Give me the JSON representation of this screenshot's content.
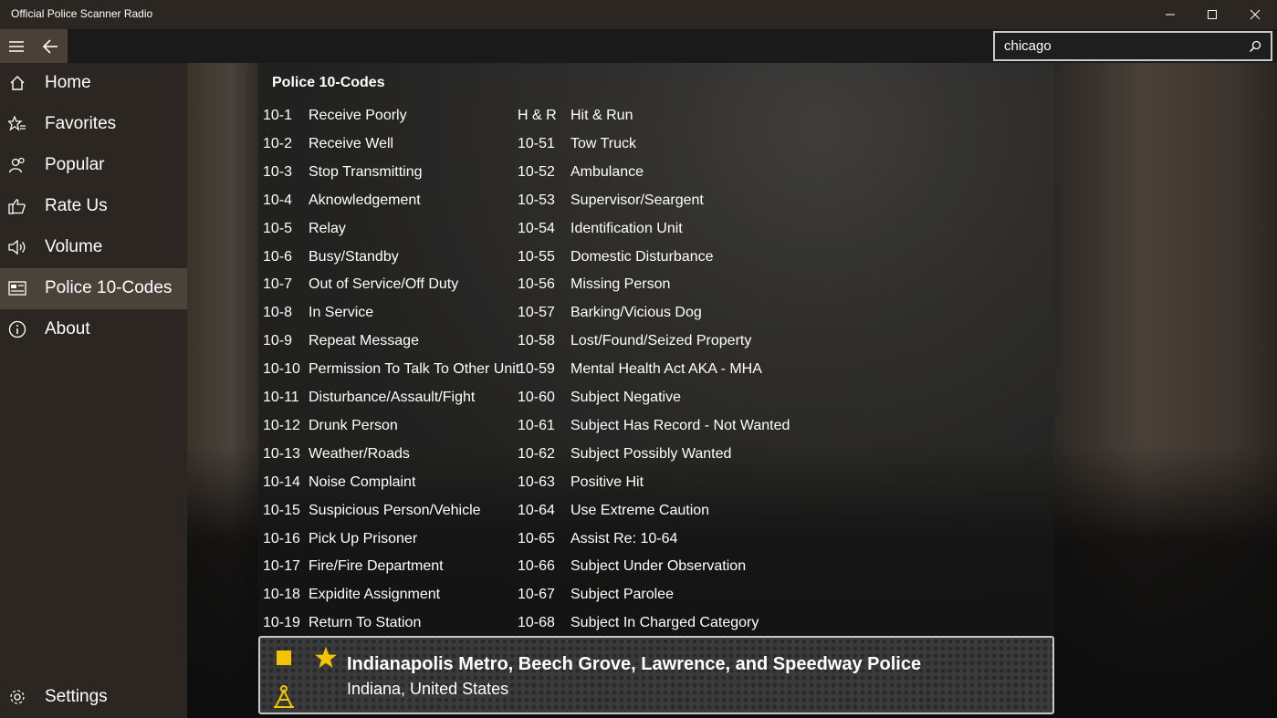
{
  "window": {
    "title": "Official Police Scanner Radio",
    "controls": [
      "minimize",
      "maximize",
      "close"
    ]
  },
  "search": {
    "value": "chicago",
    "icon": "search-icon"
  },
  "sidebar": {
    "items": [
      {
        "label": "Home",
        "icon": "home-icon",
        "active": false
      },
      {
        "label": "Favorites",
        "icon": "favorites-star-list-icon",
        "active": false
      },
      {
        "label": "Popular",
        "icon": "people-icon",
        "active": false
      },
      {
        "label": "Rate Us",
        "icon": "thumbs-up-icon",
        "active": false
      },
      {
        "label": "Volume",
        "icon": "speaker-icon",
        "active": false
      },
      {
        "label": "Police 10-Codes",
        "icon": "id-card-icon",
        "active": true
      },
      {
        "label": "About",
        "icon": "info-icon",
        "active": false
      }
    ],
    "settings_label": "Settings"
  },
  "main": {
    "title": "Police 10-Codes",
    "left_codes": [
      {
        "code": "10-1",
        "desc": "Receive Poorly"
      },
      {
        "code": "10-2",
        "desc": "Receive Well"
      },
      {
        "code": "10-3",
        "desc": "Stop Transmitting"
      },
      {
        "code": "10-4",
        "desc": "Aknowledgement"
      },
      {
        "code": "10-5",
        "desc": "Relay"
      },
      {
        "code": "10-6",
        "desc": "Busy/Standby"
      },
      {
        "code": "10-7",
        "desc": "Out of Service/Off Duty"
      },
      {
        "code": "10-8",
        "desc": "In Service"
      },
      {
        "code": "10-9",
        "desc": "Repeat Message"
      },
      {
        "code": "10-10",
        "desc": "Permission To Talk To Other Unit"
      },
      {
        "code": "10-11",
        "desc": "Disturbance/Assault/Fight"
      },
      {
        "code": "10-12",
        "desc": "Drunk Person"
      },
      {
        "code": "10-13",
        "desc": "Weather/Roads"
      },
      {
        "code": "10-14",
        "desc": "Noise Complaint"
      },
      {
        "code": "10-15",
        "desc": "Suspicious Person/Vehicle"
      },
      {
        "code": "10-16",
        "desc": "Pick Up Prisoner"
      },
      {
        "code": "10-17",
        "desc": "Fire/Fire Department"
      },
      {
        "code": "10-18",
        "desc": "Expidite Assignment"
      },
      {
        "code": "10-19",
        "desc": "Return To Station"
      }
    ],
    "right_codes": [
      {
        "code": "H & R",
        "desc": "Hit & Run"
      },
      {
        "code": "10-51",
        "desc": "Tow Truck"
      },
      {
        "code": "10-52",
        "desc": "Ambulance"
      },
      {
        "code": "10-53",
        "desc": "Supervisor/Seargent"
      },
      {
        "code": "10-54",
        "desc": "Identification Unit"
      },
      {
        "code": "10-55",
        "desc": "Domestic Disturbance"
      },
      {
        "code": "10-56",
        "desc": "Missing Person"
      },
      {
        "code": "10-57",
        "desc": "Barking/Vicious Dog"
      },
      {
        "code": "10-58",
        "desc": "Lost/Found/Seized Property"
      },
      {
        "code": "10-59",
        "desc": "Mental Health Act AKA - MHA"
      },
      {
        "code": "10-60",
        "desc": "Subject Negative"
      },
      {
        "code": "10-61",
        "desc": "Subject Has Record - Not Wanted"
      },
      {
        "code": "10-62",
        "desc": "Subject Possibly Wanted"
      },
      {
        "code": "10-63",
        "desc": "Positive Hit"
      },
      {
        "code": "10-64",
        "desc": "Use Extreme Caution"
      },
      {
        "code": "10-65",
        "desc": "Assist Re: 10-64"
      },
      {
        "code": "10-66",
        "desc": "Subject Under Observation"
      },
      {
        "code": "10-67",
        "desc": "Subject Parolee"
      },
      {
        "code": "10-68",
        "desc": "Subject In Charged Category"
      }
    ]
  },
  "player": {
    "station_name": "Indianapolis Metro, Beech Grove, Lawrence, and Speedway Police",
    "location": "Indiana, United States",
    "accent_color": "#f5c400"
  }
}
